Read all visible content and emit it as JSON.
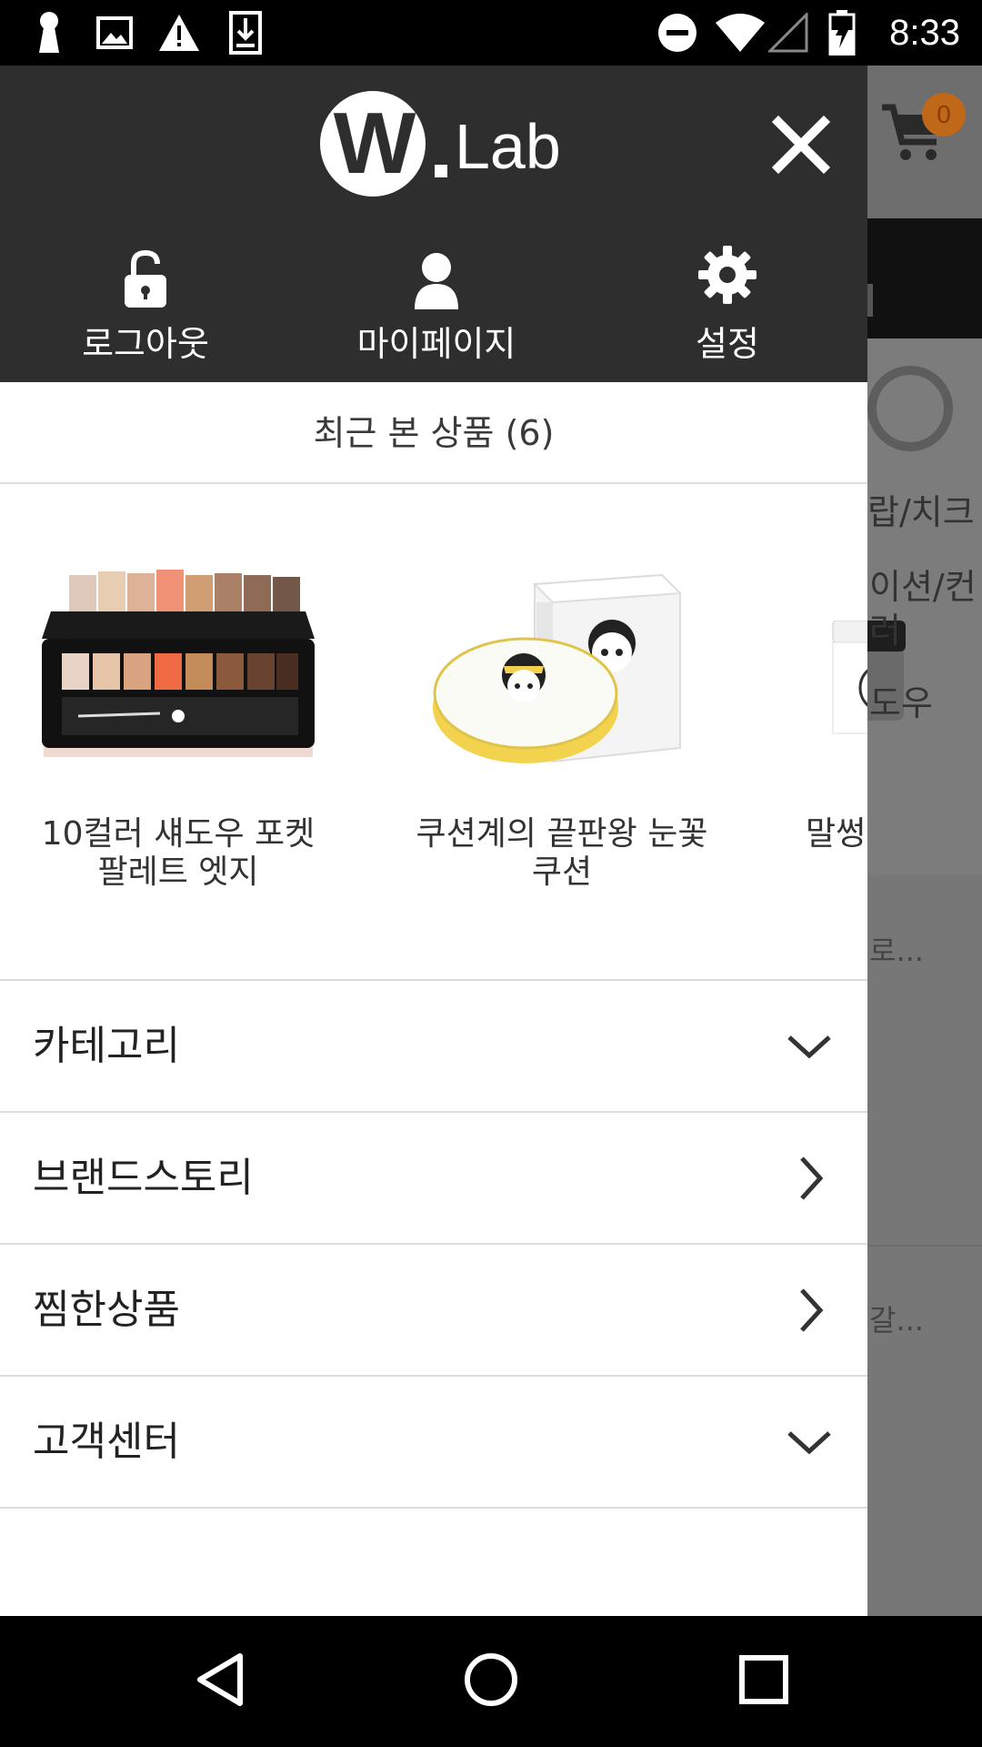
{
  "status_bar": {
    "time": "8:33",
    "icons": [
      "keyhole-icon",
      "image-icon",
      "warning-icon",
      "download-icon",
      "do-not-disturb-icon",
      "wifi-icon",
      "cell-signal-icon",
      "battery-charging-icon"
    ]
  },
  "background_page": {
    "cart_count": "0",
    "partial_texts": [
      "랍/치크",
      "이션/컨",
      "러",
      "도우",
      "로...",
      "갈..."
    ]
  },
  "drawer": {
    "logo": {
      "mark": "W",
      "text": "Lab"
    },
    "header_actions": [
      {
        "label": "로그아웃",
        "icon": "unlock-icon"
      },
      {
        "label": "마이페이지",
        "icon": "person-icon"
      },
      {
        "label": "설정",
        "icon": "gear-icon"
      }
    ],
    "recent_title": "최근 본 상품 (6)",
    "recent_products": [
      {
        "name_line1": "10컬러 섀도우 포켓",
        "name_line2": "팔레트 엣지"
      },
      {
        "name_line1": "쿠션계의 끝판왕 눈꽃",
        "name_line2": "쿠션"
      },
      {
        "name_line1": "말썽",
        "name_line2": ""
      }
    ],
    "menu": [
      {
        "label": "카테고리",
        "icon": "chevron-down-icon"
      },
      {
        "label": "브랜드스토리",
        "icon": "chevron-right-icon"
      },
      {
        "label": "찜한상품",
        "icon": "chevron-right-icon"
      },
      {
        "label": "고객센터",
        "icon": "chevron-down-icon"
      }
    ]
  },
  "nav_bar": {
    "icons": [
      "back-icon",
      "home-icon",
      "recents-icon"
    ]
  }
}
